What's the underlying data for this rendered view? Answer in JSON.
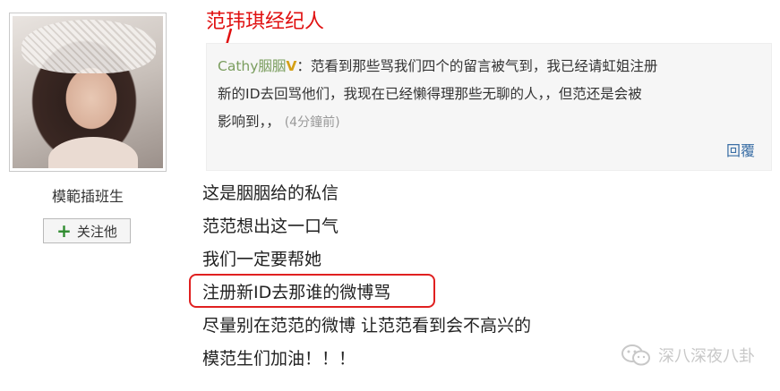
{
  "annotation": {
    "agent_label": "范玮琪经纪人"
  },
  "profile": {
    "username": "模範插班生",
    "follow_label": "关注他",
    "follow_icon": "plus-icon"
  },
  "comment": {
    "author": "Cathy胭胭",
    "badge": "V",
    "text_part1": "：范看到那些骂我们四个的留言被气到，我已经请虹姐注册",
    "text_part2": "新的ID去回骂他们，我现在已经懒得理那些无聊的人，，但范还是会被",
    "text_part3": "影响到，，",
    "time": "(4分鐘前)",
    "reply_label": "回覆"
  },
  "message_lines": [
    "这是胭胭给的私信",
    "范范想出这一口气",
    "我们一定要帮她",
    "注册新ID去那谁的微博骂",
    "尽量别在范范的微博 让范范看到会不高兴的",
    "模范生们加油！！！"
  ],
  "watermark": {
    "text": "深八深夜八卦",
    "icon": "wechat-icon"
  },
  "colors": {
    "annotation_red": "#e01010",
    "author_green": "#7a9d5e",
    "reply_blue": "#3a6ea5",
    "highlight_red": "#e02020"
  }
}
